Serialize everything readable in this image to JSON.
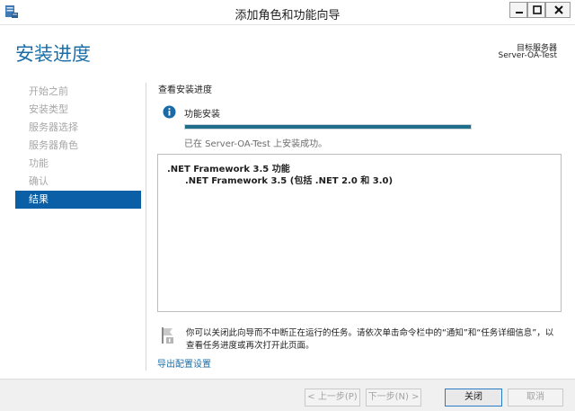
{
  "window": {
    "title": "添加角色和功能向导",
    "icons": {
      "app": "server-manager-icon",
      "minimize": "minimize-icon",
      "maximize": "maximize-icon",
      "close": "close-icon"
    }
  },
  "header": {
    "page_title": "安装进度",
    "dest_label": "目标服务器",
    "dest_server": "Server-OA-Test"
  },
  "steps": [
    {
      "label": "开始之前",
      "active": false
    },
    {
      "label": "安装类型",
      "active": false
    },
    {
      "label": "服务器选择",
      "active": false
    },
    {
      "label": "服务器角色",
      "active": false
    },
    {
      "label": "功能",
      "active": false
    },
    {
      "label": "确认",
      "active": false
    },
    {
      "label": "结果",
      "active": true
    }
  ],
  "content": {
    "section_title": "查看安装进度",
    "status_icon": "info-icon",
    "feature_install": "功能安装",
    "progress_fraction": 1.0,
    "success_msg": "已在 Server-OA-Test 上安装成功。",
    "results": {
      "title": ".NET Framework 3.5 功能",
      "sub": ".NET Framework 3.5 (包括 .NET 2.0 和 3.0)"
    },
    "note_icon": "flag-icon",
    "note_line1": "你可以关闭此向导而不中断正在运行的任务。请依次单击命令栏中的“通知”和“任务详细信息”，以",
    "note_line2": "查看任务进度或再次打开此页面。",
    "export_link": "导出配置设置"
  },
  "buttons": {
    "prev": "< 上一步(P)",
    "next": "下一步(N) >",
    "close": "关闭",
    "cancel": "取消"
  },
  "colors": {
    "accent": "#1b6fa8",
    "active_step": "#0a5fa6",
    "progress": "#1f6e8c"
  }
}
